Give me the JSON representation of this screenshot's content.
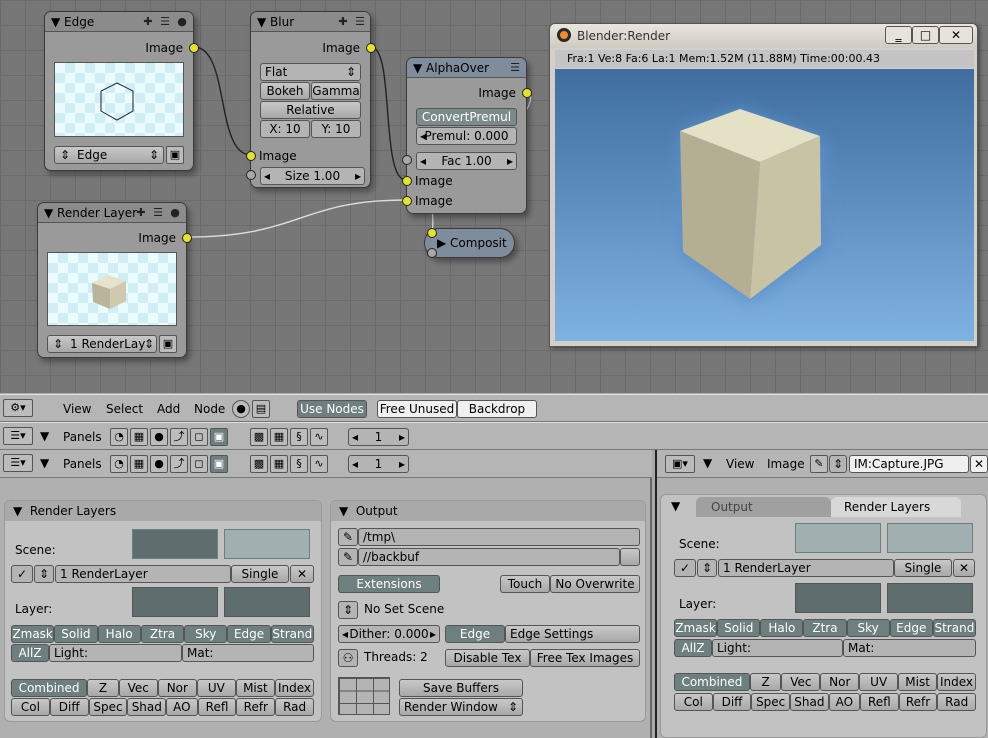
{
  "node_editor": {
    "nodes": {
      "edge": {
        "title": "Edge",
        "output": "Image",
        "select_value": "Edge"
      },
      "blur": {
        "title": "Blur",
        "output": "Image",
        "filter": "Flat",
        "bokeh": "Bokeh",
        "gamma": "Gamma",
        "relative": "Relative",
        "x": "X: 10",
        "y": "Y: 10",
        "input": "Image",
        "size": "Size 1.00"
      },
      "alphaover": {
        "title": "AlphaOver",
        "output": "Image",
        "convert": "ConvertPremul",
        "premul": "Premul: 0.000",
        "fac": "Fac 1.00",
        "input1": "Image",
        "input2": "Image"
      },
      "render_layer": {
        "title": "Render Layer",
        "output": "Image",
        "select_value": "1 RenderLay"
      },
      "composite": {
        "title": "Composit"
      }
    }
  },
  "render_window": {
    "title": "Blender:Render",
    "info": "Fra:1  Ve:8 Fa:6 La:1 Mem:1.52M (11.88M) Time:00:00.43"
  },
  "node_header": {
    "menus": [
      "View",
      "Select",
      "Add",
      "Node"
    ],
    "use_nodes": "Use Nodes",
    "free_unused": "Free Unused",
    "backdrop": "Backdrop"
  },
  "buttons_header": {
    "panels": "Panels",
    "frame": "1"
  },
  "buttons_header2": {
    "panels": "Panels",
    "frame": "1"
  },
  "image_header": {
    "view": "View",
    "image": "Image",
    "image_name": "IM:Capture.JPG"
  },
  "render_layers_panel": {
    "title": "Render Layers",
    "scene": "Scene:",
    "layer_name": "1 RenderLayer",
    "single": "Single",
    "layer": "Layer:",
    "passes_row1": [
      "Zmask",
      "Solid",
      "Halo",
      "Ztra",
      "Sky",
      "Edge",
      "Strand"
    ],
    "allz": "AllZ",
    "light": "Light:",
    "mat": "Mat:",
    "passes_row2": [
      "Combined",
      "Z",
      "Vec",
      "Nor",
      "UV",
      "Mist",
      "Index"
    ],
    "passes_row3": [
      "Col",
      "Diff",
      "Spec",
      "Shad",
      "AO",
      "Refl",
      "Refr",
      "Rad"
    ]
  },
  "output_panel": {
    "title": "Output",
    "path1": "/tmp\\",
    "path2": "//backbuf",
    "extensions": "Extensions",
    "touch": "Touch",
    "no_overwrite": "No Overwrite",
    "no_set_scene": "No Set Scene",
    "dither": "Dither: 0.000",
    "edge": "Edge",
    "edge_settings": "Edge Settings",
    "threads": "Threads: 2",
    "disable_tex": "Disable Tex",
    "free_tex_images": "Free Tex Images",
    "save_buffers": "Save Buffers",
    "render_window": "Render Window"
  },
  "right_panel": {
    "tab_output": "Output",
    "tab_render_layers": "Render Layers",
    "scene": "Scene:",
    "layer_name": "1 RenderLayer",
    "single": "Single",
    "layer": "Layer:",
    "passes_row1": [
      "Zmask",
      "Solid",
      "Halo",
      "Ztra",
      "Sky",
      "Edge",
      "Strand"
    ],
    "allz": "AllZ",
    "light": "Light:",
    "mat": "Mat:",
    "passes_row2": [
      "Combined",
      "Z",
      "Vec",
      "Nor",
      "UV",
      "Mist",
      "Index"
    ],
    "passes_row3": [
      "Col",
      "Diff",
      "Spec",
      "Shad",
      "AO",
      "Refl",
      "Refr",
      "Rad"
    ]
  }
}
